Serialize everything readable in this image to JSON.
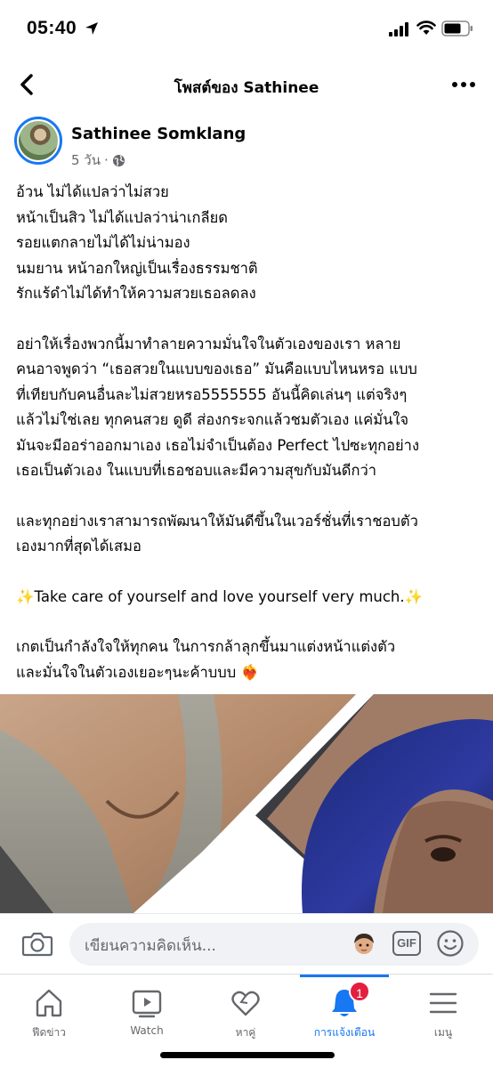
{
  "status_bar": {
    "time": "05:40",
    "icons": [
      "location-arrow-icon",
      "cellular-signal-icon",
      "wifi-icon",
      "battery-icon"
    ]
  },
  "header": {
    "title": "โพสต์ของ Sathinee",
    "back_icon": "chevron-left-icon",
    "more_icon": "more-horizontal-icon"
  },
  "post": {
    "author": "Sathinee Somklang",
    "time": "5 วัน",
    "separator": "·",
    "privacy_icon": "globe-icon",
    "paragraphs": [
      "อ้วน ไม่ได้แปลว่าไม่สวย\nหน้าเป็นสิว ไม่ได้แปลว่าน่าเกลียด\nรอยแตกลายไม่ได้ไม่น่ามอง\nนมยาน หน้าอกใหญ่เป็นเรื่องธรรมชาติ\nรักแร้ดำไม่ได้ทำให้ความสวยเธอลดลง",
      "อย่าให้เรื่องพวกนี้มาทำลายความมั่นใจในตัวเองของเรา หลาย\nคนอาจพูดว่า “เธอสวยในแบบของเธอ” มันคือแบบไหนหรอ แบบ\nที่เทียบกับคนอื่นละไม่สวยหรอ5555555 อันนี้คิดเล่นๆ แต่จริงๆ\nแล้วไม่ใช่เลย ทุกคนสวย ดูดี ส่องกระจกแล้วชมตัวเอง แค่มั่นใจ\nมันจะมีออร่าออกมาเอง เธอไม่จำเป็นต้อง Perfect ไปซะทุกอย่าง\nเธอเป็นตัวเอง ในแบบที่เธอชอบและมีความสุขกับมันดีกว่า",
      "และทุกอย่างเราสามารถพัฒนาให้มันดีขึ้นในเวอร์ชั่นที่เราชอบตัว\nเองมากที่สุดได้เสมอ"
    ],
    "english_line": "Take care of yourself and love yourself very much.",
    "sparkle": "✨",
    "closing": "เกตเป็นกำลังใจให้ทุกคน ในการกล้าลุกขึ้นมาแต่งหน้าแต่งตัว\nและมั่นใจในตัวเองเยอะๆนะค้าบบบ",
    "closing_emoji": "❤️‍🔥"
  },
  "comment_bar": {
    "placeholder": "เขียนความคิดเห็น...",
    "gif_label": "GIF",
    "icons": [
      "camera-icon",
      "avatar-sticker-icon",
      "gif-icon",
      "smiley-icon"
    ]
  },
  "bottom_nav": {
    "items": [
      {
        "label": "ฟีดข่าว",
        "icon": "home-icon"
      },
      {
        "label": "Watch",
        "icon": "watch-video-icon"
      },
      {
        "label": "หาคู่",
        "icon": "heart-icon"
      },
      {
        "label": "การแจ้งเตือน",
        "icon": "bell-icon",
        "active": true,
        "badge": "1"
      },
      {
        "label": "เมนู",
        "icon": "menu-icon"
      }
    ]
  },
  "colors": {
    "accent": "#1877f2",
    "badge": "#e41e3f",
    "secondary_text": "#65676b",
    "input_bg": "#f0f2f5"
  }
}
